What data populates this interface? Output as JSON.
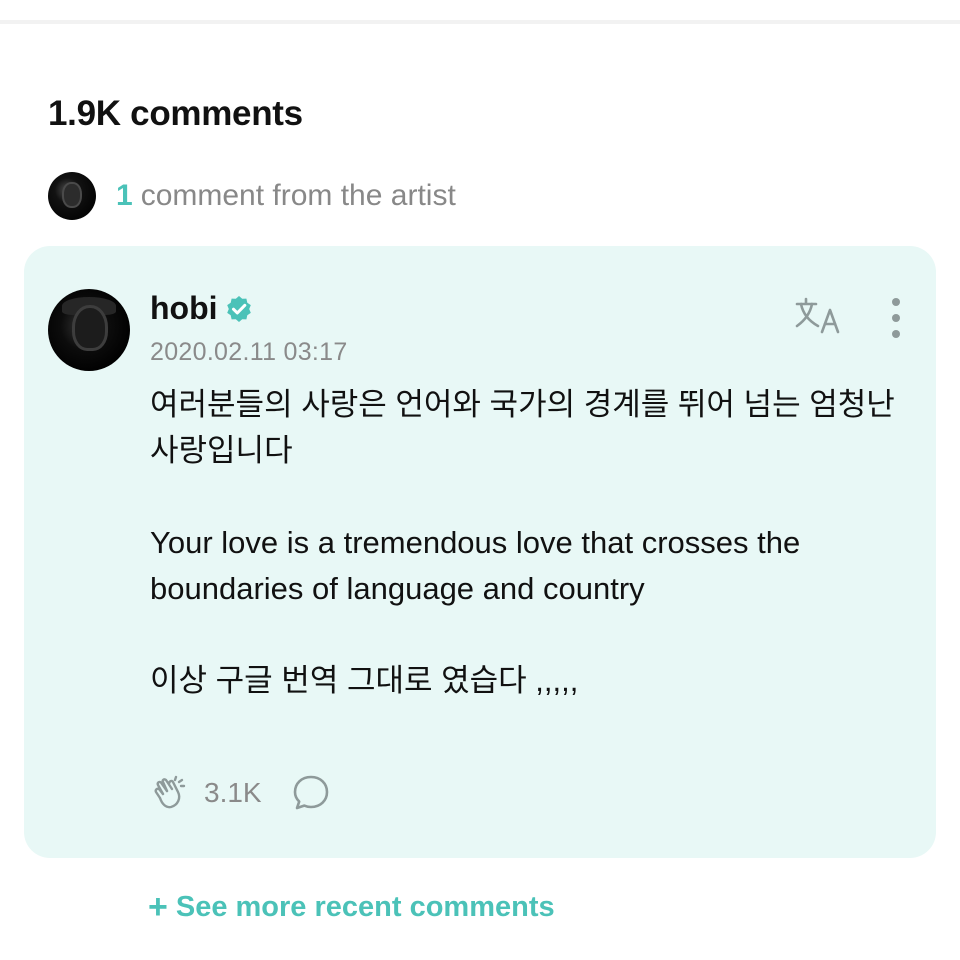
{
  "comments_header": {
    "count_label": "1.9K comments"
  },
  "artist_comments": {
    "count": "1",
    "label": "comment from the artist"
  },
  "comment": {
    "author": "hobi",
    "timestamp": "2020.02.11 03:17",
    "paragraphs": [
      "여러분들의 사랑은 언어와 국가의 경계를 뛰어 넘는 엄청난 사랑입니다",
      "Your love is a tremendous love that crosses the boundaries of language and country",
      "이상 구글 번역 그대로 였습다 ,,,,,"
    ],
    "like_count": "3.1K",
    "icons": {
      "verified": "verified-badge-icon",
      "translate": "translate-icon",
      "more": "more-vertical-icon",
      "like": "clap-hands-icon",
      "reply": "speech-bubble-icon"
    }
  },
  "see_more": {
    "label": "See more recent comments"
  },
  "colors": {
    "accent": "#4bc2b8",
    "card_background": "#e8f8f6",
    "muted_text": "#8a8a8a"
  }
}
